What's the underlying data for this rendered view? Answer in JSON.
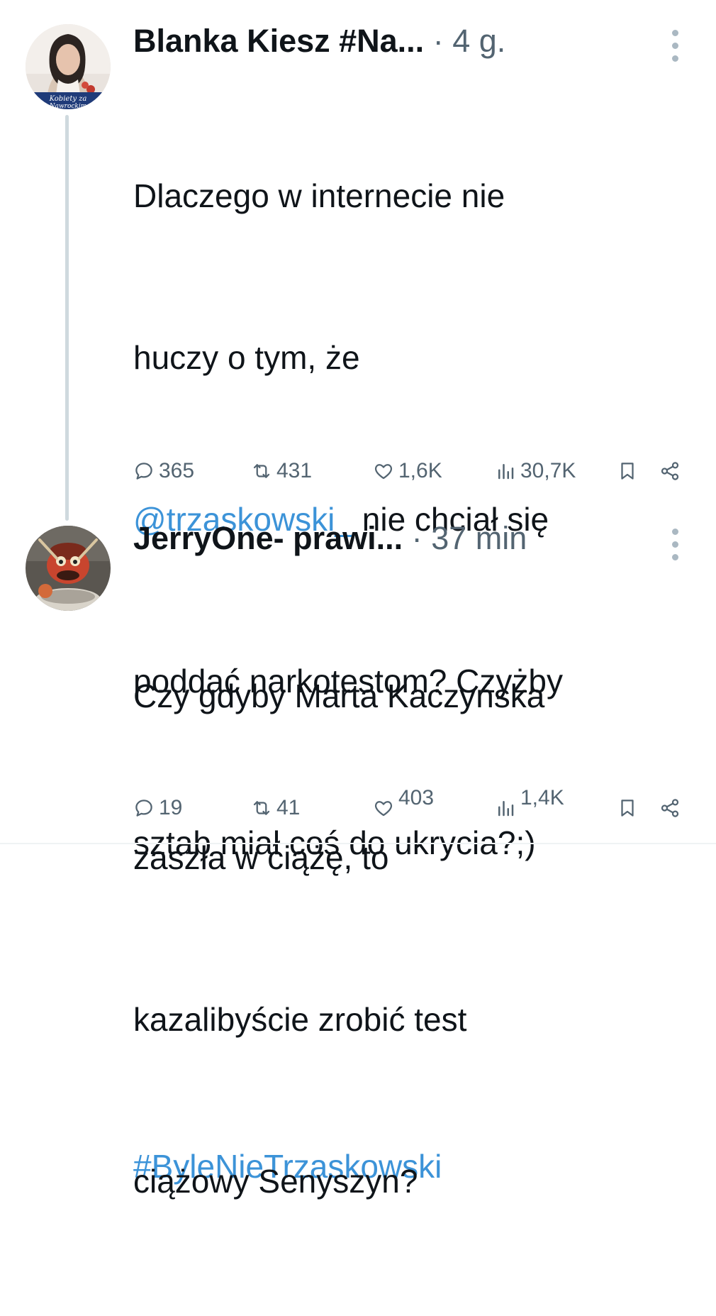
{
  "tweets": [
    {
      "author": "Blanka Kiesz #Na...",
      "separator": "·",
      "time": "4 g.",
      "text_lines": [
        "Dlaczego w internecie nie",
        "huczy o tym, że"
      ],
      "mention": "@trzaskowski_",
      "text_after_mention": " nie chciał się",
      "text_lines_2": [
        "poddać narkotestom? Czyżby",
        "sztab miał coś do ukrycia?;)"
      ],
      "hashtag": "#ByleNieTrzaskowski",
      "stats": {
        "replies": "365",
        "retweets": "431",
        "likes": "1,6K",
        "views": "30,7K"
      }
    },
    {
      "author": "JerryOne- prawi...",
      "separator": "·",
      "time": "37 min",
      "text_lines": [
        "Czy gdyby Marta Kaczyńska",
        "zaszła w ciążę, to",
        "kazalibyście zrobić test",
        "ciążowy Senyszyn?"
      ],
      "stats": {
        "replies": "19",
        "retweets": "41",
        "likes": "403",
        "views": "1,4K"
      }
    }
  ],
  "avatar_1_caption": "Kobiety za Nawrockim",
  "colors": {
    "link": "#3c93d8",
    "muted": "#536471",
    "thread_line": "#cfd9de"
  },
  "icons": [
    "reply-icon",
    "retweet-icon",
    "like-icon",
    "views-icon",
    "bookmark-icon",
    "share-icon",
    "more-icon"
  ]
}
